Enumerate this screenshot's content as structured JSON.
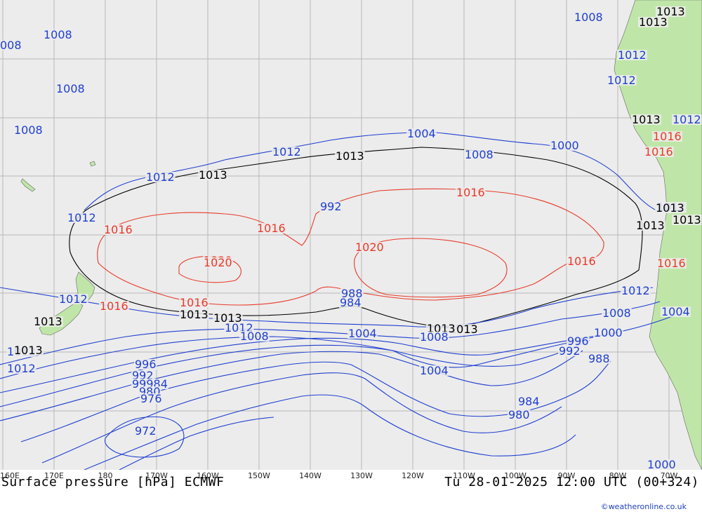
{
  "map": {
    "background_color": "#ececec",
    "land_color": "#bfe6a8",
    "grid_color": "#b8b8b8",
    "colors": {
      "low": "#1f3fd0",
      "ref": "#000000",
      "high": "#e83a2a"
    }
  },
  "lon_labels": [
    "160E",
    "170E",
    "180",
    "170W",
    "160W",
    "150W",
    "140W",
    "130W",
    "120W",
    "110W",
    "100W",
    "90W",
    "80W",
    "70W"
  ],
  "contour_labels": [
    {
      "t": "1008",
      "c": "low"
    },
    {
      "t": "008",
      "c": "low"
    },
    {
      "t": "1008",
      "c": "low"
    },
    {
      "t": "1008",
      "c": "low"
    },
    {
      "t": "1008",
      "c": "low"
    },
    {
      "t": "1013",
      "c": "ref"
    },
    {
      "t": "1013",
      "c": "ref"
    },
    {
      "t": "1012",
      "c": "low"
    },
    {
      "t": "1012",
      "c": "low"
    },
    {
      "t": "1012",
      "c": "low"
    },
    {
      "t": "1012",
      "c": "low"
    },
    {
      "t": "1013",
      "c": "ref"
    },
    {
      "t": "1013",
      "c": "ref"
    },
    {
      "t": "1013",
      "c": "ref"
    },
    {
      "t": "1013",
      "c": "ref"
    },
    {
      "t": "1016",
      "c": "high"
    },
    {
      "t": "1016",
      "c": "high"
    },
    {
      "t": "1016",
      "c": "high"
    },
    {
      "t": "1016",
      "c": "high"
    },
    {
      "t": "1016",
      "c": "high"
    },
    {
      "t": "1020",
      "c": "high"
    },
    {
      "t": "1020",
      "c": "high"
    },
    {
      "t": "1016",
      "c": "high"
    },
    {
      "t": "1016",
      "c": "high"
    },
    {
      "t": "1012",
      "c": "low"
    },
    {
      "t": "1012",
      "c": "low"
    },
    {
      "t": "1013",
      "c": "ref"
    },
    {
      "t": "1013",
      "c": "ref"
    },
    {
      "t": "1012",
      "c": "low"
    },
    {
      "t": "1008",
      "c": "low"
    },
    {
      "t": "1004",
      "c": "low"
    },
    {
      "t": "1000",
      "c": "low"
    },
    {
      "t": "992",
      "c": "low"
    },
    {
      "t": "988",
      "c": "low"
    },
    {
      "t": "984",
      "c": "low"
    },
    {
      "t": "1013",
      "c": "ref"
    },
    {
      "t": "1013",
      "c": "ref"
    },
    {
      "t": "1012",
      "c": "low"
    },
    {
      "t": "1008",
      "c": "low"
    },
    {
      "t": "1013",
      "c": "ref"
    },
    {
      "t": "1013",
      "c": "ref"
    },
    {
      "t": "1012",
      "c": "low"
    },
    {
      "t": "1008",
      "c": "low"
    },
    {
      "t": "1008",
      "c": "low"
    },
    {
      "t": "1004",
      "c": "low"
    },
    {
      "t": "1000",
      "c": "low"
    },
    {
      "t": "996",
      "c": "low"
    },
    {
      "t": "992",
      "c": "low"
    },
    {
      "t": "988",
      "c": "low"
    },
    {
      "t": "1004",
      "c": "low"
    },
    {
      "t": "984",
      "c": "low"
    },
    {
      "t": "980",
      "c": "low"
    },
    {
      "t": "996",
      "c": "low"
    },
    {
      "t": "992",
      "c": "low"
    },
    {
      "t": "99984",
      "c": "low"
    },
    {
      "t": "980",
      "c": "low"
    },
    {
      "t": "976",
      "c": "low"
    },
    {
      "t": "972",
      "c": "low"
    },
    {
      "t": "1000",
      "c": "low"
    },
    {
      "t": "1004",
      "c": "low"
    },
    {
      "t": "1012",
      "c": "low"
    },
    {
      "t": "1016",
      "c": "high"
    },
    {
      "t": "1016",
      "c": "high"
    },
    {
      "t": "1020",
      "c": "high"
    },
    {
      "t": "1013",
      "c": "ref"
    },
    {
      "t": "1012",
      "c": "low"
    },
    {
      "t": "1013",
      "c": "ref"
    },
    {
      "t": "1012",
      "c": "low"
    }
  ],
  "footer": {
    "title_left": "Surface pressure [hPa] ECMWF",
    "title_right": "Tu 28-01-2025 12:00 UTC (00+324)",
    "credit": "©weatheronline.co.uk"
  }
}
